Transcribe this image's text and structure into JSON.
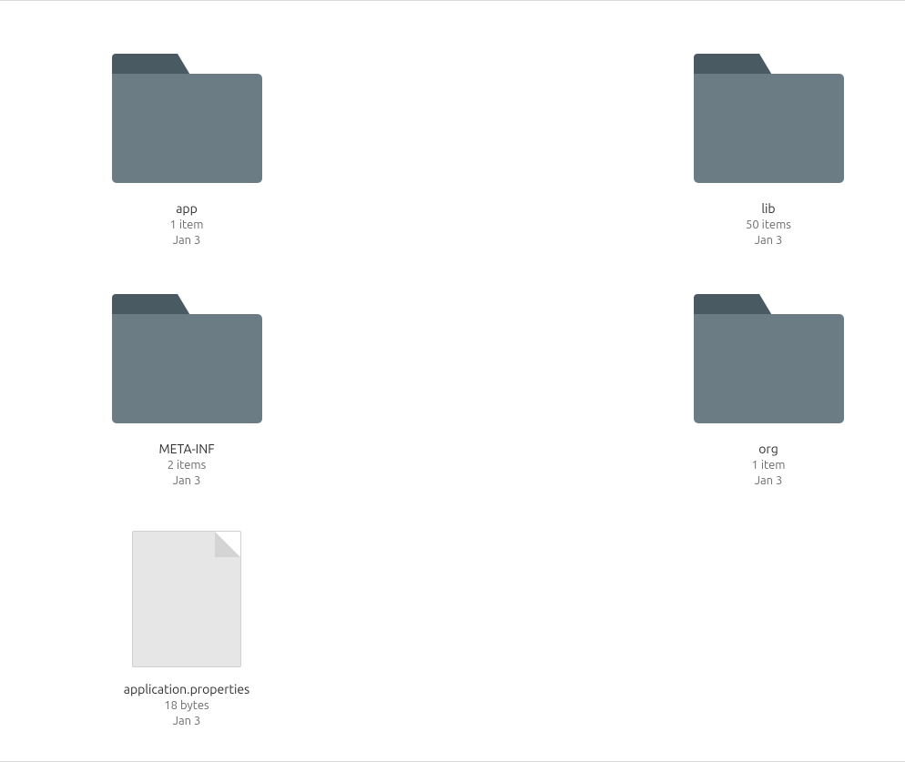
{
  "items": [
    {
      "name": "app",
      "kind": "folder",
      "count": "1 item",
      "date": "Jan 3"
    },
    {
      "name": "lib",
      "kind": "folder",
      "count": "50 items",
      "date": "Jan 3"
    },
    {
      "name": "META-INF",
      "kind": "folder",
      "count": "2 items",
      "date": "Jan 3"
    },
    {
      "name": "org",
      "kind": "folder",
      "count": "1 item",
      "date": "Jan 3"
    },
    {
      "name": "application.properties",
      "kind": "file",
      "count": "18 bytes",
      "date": "Jan 3"
    }
  ]
}
